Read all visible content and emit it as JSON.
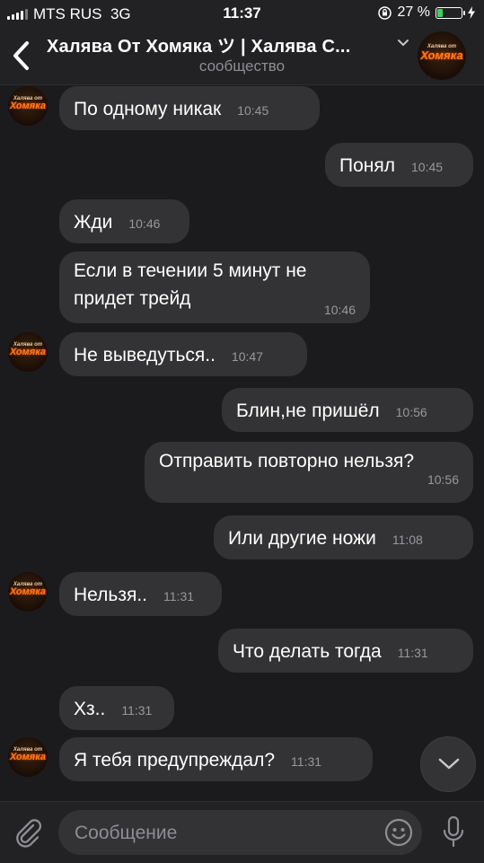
{
  "status": {
    "carrier": "MTS RUS",
    "network": "3G",
    "time": "11:37",
    "battery": "27 %",
    "battery_level": 0.27
  },
  "header": {
    "title": "Халява От Хомяка ツ | Халява С...",
    "subtitle": "сообщество",
    "avatar": {
      "top": "Халява от",
      "main": "Хомяка",
      "bottom": ""
    }
  },
  "messages": [
    {
      "side": "in",
      "text": "По одному никак",
      "time": "10:45",
      "avatar": true
    },
    {
      "side": "out",
      "text": "Понял",
      "time": "10:45"
    },
    {
      "side": "in",
      "text": "Жди",
      "time": "10:46"
    },
    {
      "side": "in",
      "text": "Если в течении 5 минут не\nпридет трейд",
      "time": "10:46"
    },
    {
      "side": "in",
      "text": "Не выведуться..",
      "time": "10:47",
      "avatar": true
    },
    {
      "side": "out",
      "text": "Блин,не пришёл",
      "time": "10:56"
    },
    {
      "side": "out",
      "text": "Отправить повторно нельзя?",
      "time": "10:56"
    },
    {
      "side": "out",
      "text": "Или другие ножи",
      "time": "11:08"
    },
    {
      "side": "in",
      "text": "Нельзя..",
      "time": "11:31",
      "avatar": true
    },
    {
      "side": "out",
      "text": "Что делать тогда",
      "time": "11:31"
    },
    {
      "side": "in",
      "text": "Хз..",
      "time": "11:31"
    },
    {
      "side": "in",
      "text": "Я тебя предупреждал?",
      "time": "11:31",
      "avatar": true
    }
  ],
  "input": {
    "placeholder": "Сообщение"
  },
  "icons": {
    "back": "chevron-left-icon",
    "expand": "chevron-down-icon",
    "attach": "paperclip-icon",
    "emoji": "smiley-icon",
    "mic": "microphone-icon",
    "scroll_down": "chevron-down-icon"
  },
  "colors": {
    "background": "#1b1b1d",
    "bubble": "#333335",
    "bar": "#222224",
    "accent": "#ff7a1f",
    "battery": "#3fd15a"
  }
}
